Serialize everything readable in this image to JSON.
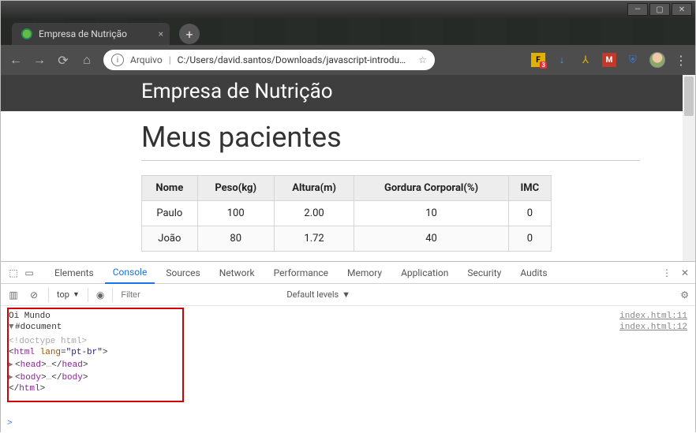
{
  "window": {
    "min": "—",
    "max": "▢",
    "close": "✕"
  },
  "tab": {
    "title": "Empresa de Nutrição",
    "close": "×"
  },
  "newtab": "+",
  "nav": {
    "back": "←",
    "forward": "→",
    "reload": "⟳",
    "home": "⌂"
  },
  "omnibox": {
    "scheme_label": "Arquivo",
    "sep": "|",
    "url": "C:/Users/david.santos/Downloads/javascript-introdu…",
    "star": "☆"
  },
  "ext": {
    "download": "↓",
    "menu": "⋮"
  },
  "page": {
    "site_title": "Empresa de Nutrição",
    "heading": "Meus pacientes",
    "columns": [
      "Nome",
      "Peso(kg)",
      "Altura(m)",
      "Gordura Corporal(%)",
      "IMC"
    ],
    "rows": [
      {
        "nome": "Paulo",
        "peso": "100",
        "altura": "2.00",
        "gordura": "10",
        "imc": "0"
      },
      {
        "nome": "João",
        "peso": "80",
        "altura": "1.72",
        "gordura": "40",
        "imc": "0"
      }
    ]
  },
  "devtools": {
    "tabs": [
      "Elements",
      "Console",
      "Sources",
      "Network",
      "Performance",
      "Memory",
      "Application",
      "Security",
      "Audits"
    ],
    "active_tab": "Console",
    "kebab": "⋮",
    "close": "✕",
    "controls": {
      "stop": "⊘",
      "context": "top",
      "eye": "◉",
      "filter_placeholder": "Filter",
      "levels": "Default levels",
      "gear": "⚙"
    },
    "console": {
      "log_text": "Oi Mundo",
      "log_src": "index.html:11",
      "doc_label": "#document",
      "doc_src": "index.html:12",
      "doctype": "<!doctype html>",
      "html_open_tag": "html",
      "html_attr_name": "lang",
      "html_attr_val": "\"pt-br\"",
      "head_tag": "head",
      "body_tag": "body",
      "ellipsis": "…",
      "html_close": "html",
      "prompt": ">"
    }
  }
}
